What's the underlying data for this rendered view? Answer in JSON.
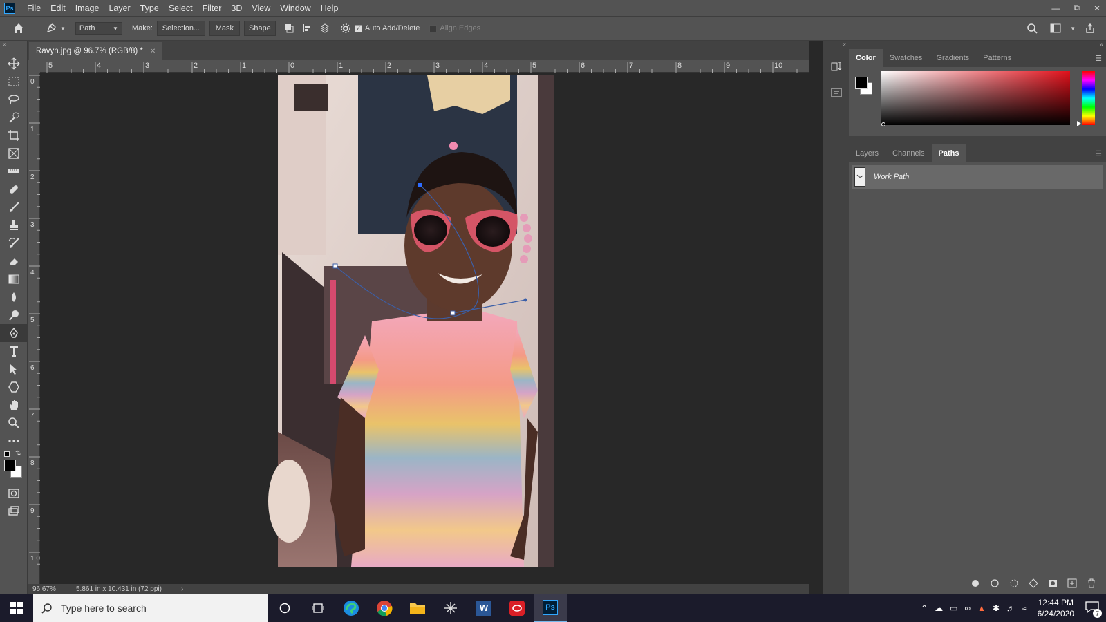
{
  "app": {
    "logo": "Ps"
  },
  "menu": [
    "File",
    "Edit",
    "Image",
    "Layer",
    "Type",
    "Select",
    "Filter",
    "3D",
    "View",
    "Window",
    "Help"
  ],
  "options": {
    "mode_value": "Path",
    "make_label": "Make:",
    "selection_label": "Selection...",
    "mask_label": "Mask",
    "shape_label": "Shape",
    "auto_add_label": "Auto Add/Delete",
    "align_edges_label": "Align Edges",
    "auto_add_checked": true,
    "align_edges_checked": false
  },
  "document": {
    "tab_title": "Ravyn.jpg @ 96.7% (RGB/8) *",
    "ruler_h_labels": [
      "5",
      "4",
      "3",
      "2",
      "1",
      "0",
      "1",
      "2",
      "3",
      "4",
      "5",
      "6",
      "7",
      "8",
      "9",
      "10"
    ],
    "ruler_v_labels": [
      "0",
      "1",
      "2",
      "3",
      "4",
      "5",
      "6",
      "7",
      "8",
      "9",
      "1\n0"
    ]
  },
  "status": {
    "zoom": "96.67%",
    "doc_info": "5.861 in x 10.431 in (72 ppi)"
  },
  "color_panel": {
    "tabs": [
      "Color",
      "Swatches",
      "Gradients",
      "Patterns"
    ],
    "active_tab": "Color",
    "foreground": "#000000",
    "background": "#ffffff",
    "hue_color": "#e0101a"
  },
  "paths_panel": {
    "tabs": [
      "Layers",
      "Channels",
      "Paths"
    ],
    "active_tab": "Paths",
    "items": [
      {
        "name": "Work Path"
      }
    ]
  },
  "taskbar": {
    "search_placeholder": "Type here to search",
    "time": "12:44 PM",
    "date": "6/24/2020",
    "notification_count": "7",
    "word_label": "W",
    "ps_label": "Ps"
  }
}
